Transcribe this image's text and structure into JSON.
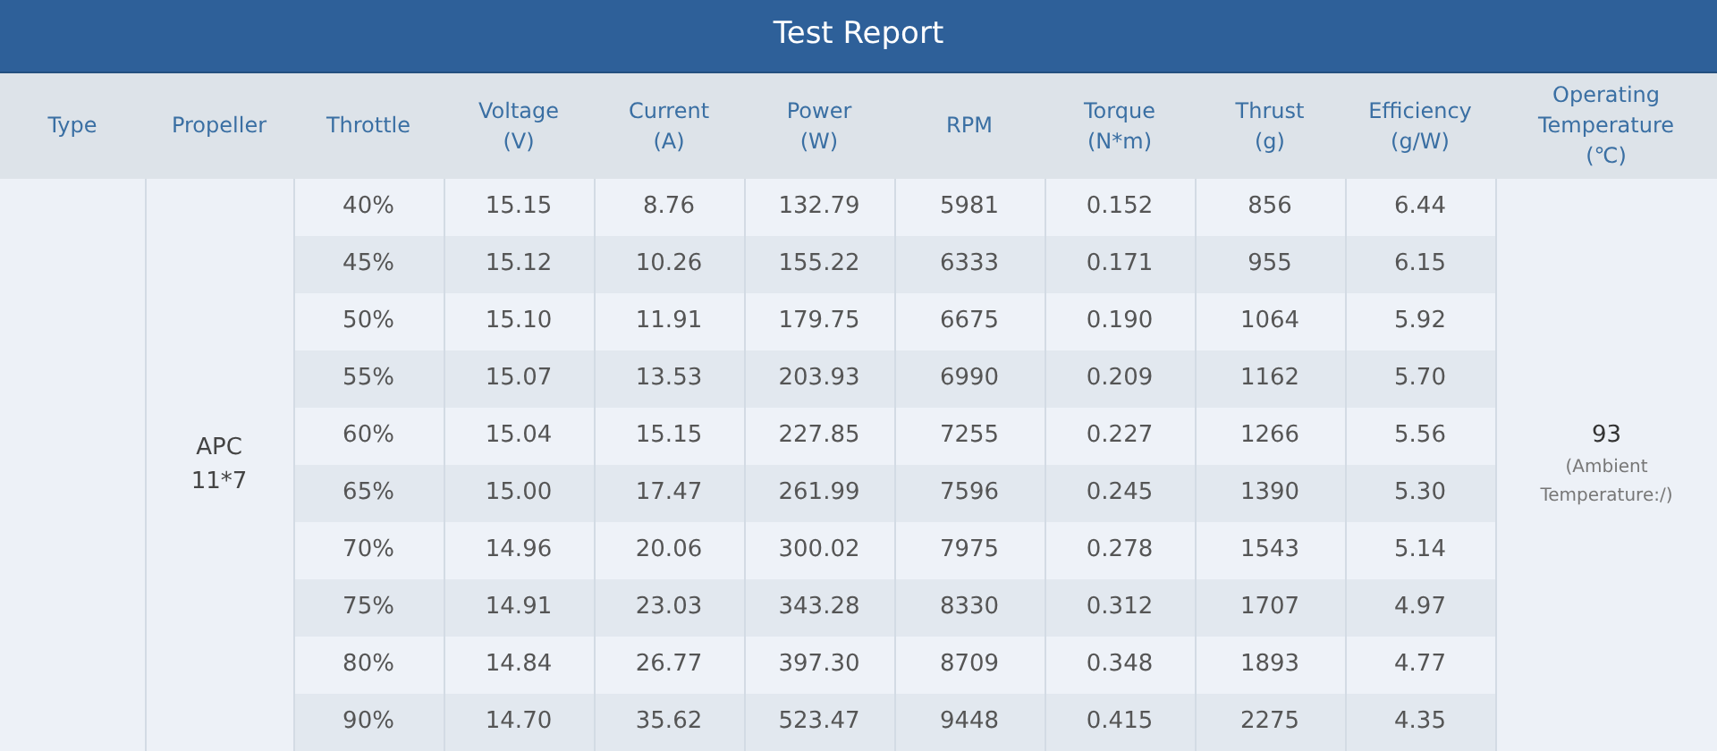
{
  "title": "Test Report",
  "columns": [
    "Type",
    "Propeller",
    "Throttle",
    "Voltage\n(V)",
    "Current\n(A)",
    "Power\n(W)",
    "RPM",
    "Torque\n(N*m)",
    "Thrust\n(g)",
    "Efficiency\n(g/W)",
    "Operating\nTemperature\n(℃)"
  ],
  "propeller": "APC\n11*7",
  "temperature": {
    "value": "93",
    "note": "(Ambient\nTemperature:/)"
  },
  "rows": [
    [
      "40%",
      "15.15",
      "8.76",
      "132.79",
      "5981",
      "0.152",
      "856",
      "6.44"
    ],
    [
      "45%",
      "15.12",
      "10.26",
      "155.22",
      "6333",
      "0.171",
      "955",
      "6.15"
    ],
    [
      "50%",
      "15.10",
      "11.91",
      "179.75",
      "6675",
      "0.190",
      "1064",
      "5.92"
    ],
    [
      "55%",
      "15.07",
      "13.53",
      "203.93",
      "6990",
      "0.209",
      "1162",
      "5.70"
    ],
    [
      "60%",
      "15.04",
      "15.15",
      "227.85",
      "7255",
      "0.227",
      "1266",
      "5.56"
    ],
    [
      "65%",
      "15.00",
      "17.47",
      "261.99",
      "7596",
      "0.245",
      "1390",
      "5.30"
    ],
    [
      "70%",
      "14.96",
      "20.06",
      "300.02",
      "7975",
      "0.278",
      "1543",
      "5.14"
    ],
    [
      "75%",
      "14.91",
      "23.03",
      "343.28",
      "8330",
      "0.312",
      "1707",
      "4.97"
    ],
    [
      "80%",
      "14.84",
      "26.77",
      "397.30",
      "8709",
      "0.348",
      "1893",
      "4.77"
    ],
    [
      "90%",
      "14.70",
      "35.62",
      "523.47",
      "9448",
      "0.415",
      "2275",
      "4.35"
    ]
  ]
}
